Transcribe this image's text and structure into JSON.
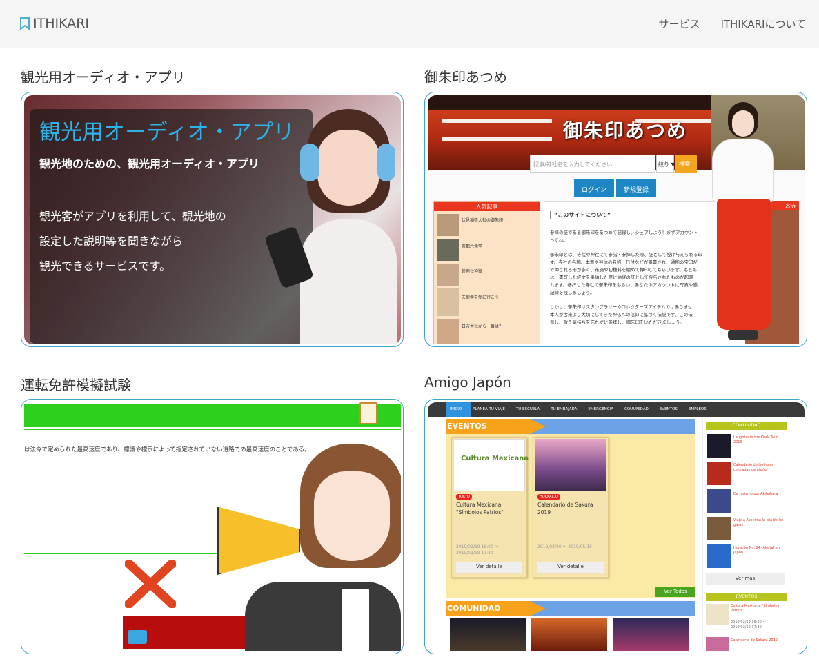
{
  "nav": {
    "brand": "ITHIKARI",
    "links": [
      "サービス",
      "ITHIKARIについて"
    ]
  },
  "cards": [
    {
      "title": "観光用オーディオ・アプリ"
    },
    {
      "title": "御朱印あつめ"
    },
    {
      "title": "運転免許模擬試験"
    },
    {
      "title": "Amigo Japón"
    }
  ],
  "audio": {
    "heading": "観光用オーディオ・アプリ",
    "sub": "観光地のための、観光用オーディオ・アプリ",
    "desc": [
      "観光客がアプリを利用して、観光地の",
      "設定した説明等を聞きながら",
      "観光できるサービスです。"
    ]
  },
  "goshuin": {
    "logo": "御朱印あつめ",
    "search_placeholder": "記事/神社名を入力してください",
    "select": "絞り ▼",
    "search_btn": "検索",
    "login": "ログイン",
    "register": "新規登録",
    "popular": "人気記事",
    "right_tab": "お寺",
    "about_title": "“このサイトについて”",
    "about": [
      "参拝の証である御朱印をあつめて記録し、シェアしよう！まずアカウント",
      "ってね。",
      "御朱印とは、寺院や神社にて参詣・参拝した際、証として授け与えられる印",
      "す。寺社の名称、本尊や神体の名称、日付などが墨書され、通称の宝印が",
      "で押される形が多く、布施や初穂料を納めて押印してもらいます。もとも",
      "は、書写した経文を奉納した際に納経の証として授与されたものが起源",
      "れます。参拝した寺社で御朱印をもらい、あなたのアカウントに写真や感",
      "記録を残しましょう。",
      "しかし、御朱印はスタンプラリーやコレクターズアイテムではありませ",
      "本人が古来より大切にしてきた神仏への信仰に基づく伝統です。この伝",
      "意し、敬う気持ちを忘れずに参拝し、御朱印をいただきましょう。"
    ],
    "popular_items": [
      "伏見稲荷大社の御朱印",
      "京都六角堂",
      "鈴鹿社神御",
      "天龍寺を愛に行こう！",
      "日吉大社から一番は？"
    ]
  },
  "driving": {
    "text": "は法令で定められた最高速度であり、標識や標示によって指定されていない道路での最高速度のことである。"
  },
  "amigo": {
    "menu": [
      "INICIO",
      "PLANEA TU VIAJE",
      "TU ESCUELA",
      "TU EMBAJADA",
      "EMERGENCIA",
      "COMUNIDAD",
      "EVENTOS",
      "EMPLEOS"
    ],
    "eventos": "EVENTOS",
    "comunidad": "COMUNIDAD",
    "ver_todos": "Ver Todos",
    "events": [
      {
        "tag": "TOKYO",
        "title": "Cultura Mexicana \"Símbolos Patrios\"",
        "dates": "2019/02/19 16:00 ～ 2019/02/19 17:30",
        "btn": "Ver detalle",
        "poster": "Cultura Mexicana"
      },
      {
        "tag": "HOKKAIDO",
        "title": "Calendario de Sakura 2019",
        "dates": "2019/03/20 ～ 2019/05/15",
        "btn": "Ver detalle"
      }
    ],
    "side_comunidad": "COMUNIDAD",
    "side_items": [
      "Laughter in the Dark Tour 2019",
      "Calendario de las hojas coloradas de otoño",
      "De turismo por Akihabara",
      "Viaje a Aoshima la isla de los gatos",
      "Huracán No. 24 [Alerta] en Japón"
    ],
    "ver_mas": "Ver más",
    "side_eventos": "EVENTOS",
    "side_events": [
      "Cultura Mexicana \"Símbolos Patrios\"",
      "2019/02/19 16:00 ～ 2019/02/19 17:30",
      "Calendario de Sakura 2019"
    ]
  },
  "colors": {
    "accent": "#3aa6c8",
    "green": "#2ed01e",
    "orange": "#f6a21a",
    "red": "#e8391f"
  }
}
